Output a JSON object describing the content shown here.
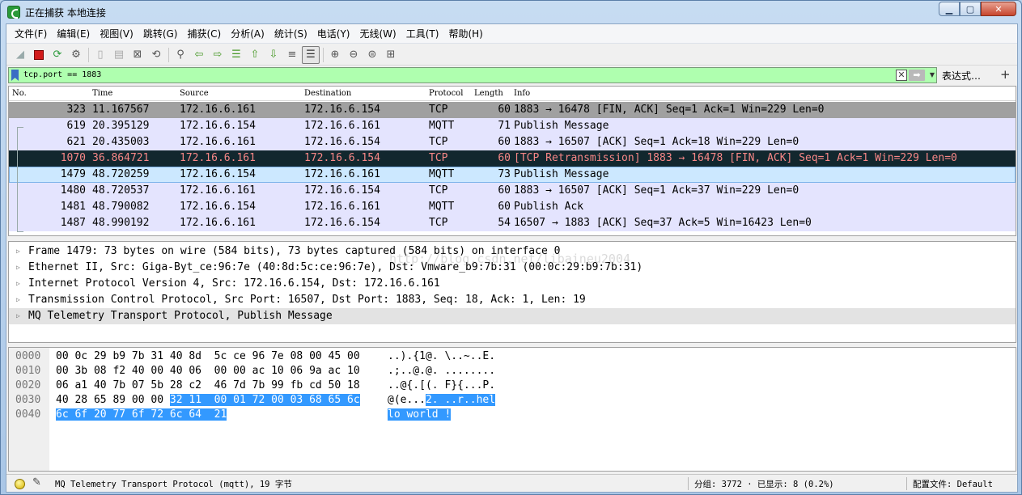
{
  "window": {
    "title": "正在捕获 本地连接"
  },
  "menu": [
    "文件(F)",
    "编辑(E)",
    "视图(V)",
    "跳转(G)",
    "捕获(C)",
    "分析(A)",
    "统计(S)",
    "电话(Y)",
    "无线(W)",
    "工具(T)",
    "帮助(H)"
  ],
  "filter": {
    "value": "tcp.port == 1883",
    "expression_label": "表达式…",
    "plus_label": "+"
  },
  "columns": {
    "no": "No.",
    "time": "Time",
    "source": "Source",
    "destination": "Destination",
    "protocol": "Protocol",
    "length": "Length",
    "info": "Info"
  },
  "packets": [
    {
      "no": "323",
      "time": "11.167567",
      "src": "172.16.6.161",
      "dst": "172.16.6.154",
      "proto": "TCP",
      "len": "60",
      "info": "1883 → 16478 [FIN, ACK] Seq=1 Ack=1 Win=229 Len=0"
    },
    {
      "no": "619",
      "time": "20.395129",
      "src": "172.16.6.154",
      "dst": "172.16.6.161",
      "proto": "MQTT",
      "len": "71",
      "info": "Publish Message"
    },
    {
      "no": "621",
      "time": "20.435003",
      "src": "172.16.6.161",
      "dst": "172.16.6.154",
      "proto": "TCP",
      "len": "60",
      "info": "1883 → 16507 [ACK] Seq=1 Ack=18 Win=229 Len=0"
    },
    {
      "no": "1070",
      "time": "36.864721",
      "src": "172.16.6.161",
      "dst": "172.16.6.154",
      "proto": "TCP",
      "len": "60",
      "info": "[TCP Retransmission] 1883 → 16478 [FIN, ACK] Seq=1 Ack=1 Win=229 Len=0"
    },
    {
      "no": "1479",
      "time": "48.720259",
      "src": "172.16.6.154",
      "dst": "172.16.6.161",
      "proto": "MQTT",
      "len": "73",
      "info": "Publish Message"
    },
    {
      "no": "1480",
      "time": "48.720537",
      "src": "172.16.6.161",
      "dst": "172.16.6.154",
      "proto": "TCP",
      "len": "60",
      "info": "1883 → 16507 [ACK] Seq=1 Ack=37 Win=229 Len=0"
    },
    {
      "no": "1481",
      "time": "48.790082",
      "src": "172.16.6.154",
      "dst": "172.16.6.161",
      "proto": "MQTT",
      "len": "60",
      "info": "Publish Ack"
    },
    {
      "no": "1487",
      "time": "48.990192",
      "src": "172.16.6.161",
      "dst": "172.16.6.154",
      "proto": "TCP",
      "len": "54",
      "info": "16507 → 1883 [ACK] Seq=37 Ack=5 Win=16423 Len=0"
    }
  ],
  "row_colors": {
    "fin": "#a0a0a0",
    "normal": "#e4e4fe",
    "retrans_bg": "#12272e",
    "retrans_fg": "#f78787",
    "selected": "#cce8ff"
  },
  "details": [
    "Frame 1479: 73 bytes on wire (584 bits), 73 bytes captured (584 bits) on interface 0",
    "Ethernet II, Src: Giga-Byt_ce:96:7e (40:8d:5c:ce:96:7e), Dst: Vmware_b9:7b:31 (00:0c:29:b9:7b:31)",
    "Internet Protocol Version 4, Src: 172.16.6.154, Dst: 172.16.6.161",
    "Transmission Control Protocol, Src Port: 16507, Dst Port: 1883, Seq: 18, Ack: 1, Len: 19",
    "MQ Telemetry Transport Protocol, Publish Message"
  ],
  "watermark": "http://blog.csdn.net/libaineu2004",
  "bytes": [
    {
      "offset": "0000",
      "hex": "00 0c 29 b9 7b 31 40 8d  5c ce 96 7e 08 00 45 00",
      "hex_hl": "",
      "ascii": "..).{1@. \\..~..E.",
      "ascii_hl": ""
    },
    {
      "offset": "0010",
      "hex": "00 3b 08 f2 40 00 40 06  00 00 ac 10 06 9a ac 10",
      "hex_hl": "",
      "ascii": ".;..@.@. ........",
      "ascii_hl": ""
    },
    {
      "offset": "0020",
      "hex": "06 a1 40 7b 07 5b 28 c2  46 7d 7b 99 fb cd 50 18",
      "hex_hl": "",
      "ascii": "..@{.[(. F}{...P.",
      "ascii_hl": ""
    },
    {
      "offset": "0030",
      "hex": "40 28 65 89 00 00 ",
      "hex_hl": "32 11  00 01 72 00 03 68 65 6c",
      "ascii": "@(e...",
      "ascii_hl": "2. ..r..hel"
    },
    {
      "offset": "0040",
      "hex": "",
      "hex_hl": "6c 6f 20 77 6f 72 6c 64  21",
      "ascii": "",
      "ascii_hl": "lo world !"
    }
  ],
  "status": {
    "text": "MQ Telemetry Transport Protocol (mqtt), 19 字节",
    "packets": "分组: 3772 · 已显示: 8 (0.2%)",
    "profile": "配置文件: Default"
  }
}
